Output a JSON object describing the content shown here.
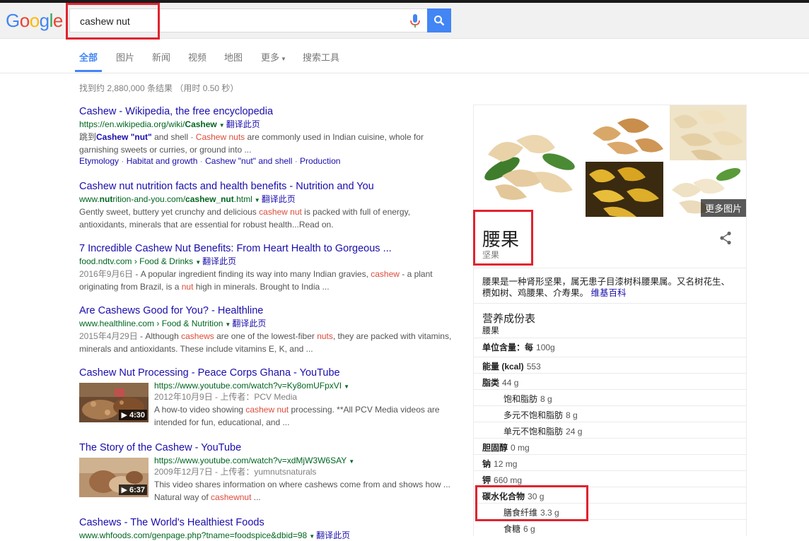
{
  "header": {
    "logo_letters": [
      {
        "ch": "G",
        "color": "#4285f4"
      },
      {
        "ch": "o",
        "color": "#ea4335"
      },
      {
        "ch": "o",
        "color": "#fbbc05"
      },
      {
        "ch": "g",
        "color": "#4285f4"
      },
      {
        "ch": "l",
        "color": "#34a853"
      },
      {
        "ch": "e",
        "color": "#ea4335"
      }
    ],
    "search_value": "cashew nut",
    "mic_icon": "microphone-icon",
    "search_icon": "magnifier-icon"
  },
  "tabs": [
    {
      "label": "全部",
      "active": true
    },
    {
      "label": "图片"
    },
    {
      "label": "新闻"
    },
    {
      "label": "视频"
    },
    {
      "label": "地图"
    },
    {
      "label": "更多"
    },
    {
      "label": "搜索工具"
    }
  ],
  "stats": "找到约 2,880,000 条结果 （用时 0.50 秒）",
  "results": [
    {
      "title": "Cashew - Wikipedia, the free encyclopedia",
      "url_pre": "https://en.wikipedia.org/wiki/",
      "url_bold": "Cashew",
      "translate": "翻译此页",
      "snip_p1": "跳到",
      "snip_b1": "Cashew \"nut\"",
      "snip_p2": " and shell · ",
      "snip_em": "Cashew nuts",
      "snip_p3": " are commonly used in Indian cuisine, whole for garnishing sweets or curries, or ground into ...",
      "sitelinks": [
        "Etymology",
        "Habitat and growth",
        "Cashew \"nut\" and shell",
        "Production"
      ],
      "sep": " · "
    },
    {
      "title": "Cashew nut nutrition facts and health benefits - Nutrition and You",
      "url_p1": "www.",
      "url_b1": "nut",
      "url_p2": "rition-and-you.com/",
      "url_b2": "cashew_nut",
      "url_p3": ".html",
      "translate": "翻译此页",
      "snip_p1": "Gently sweet, buttery yet crunchy and delicious ",
      "snip_em": "cashew nut",
      "snip_p2": " is packed with full of energy, antioxidants, minerals that are essential for robust health...Read on."
    },
    {
      "title": "7 Incredible Cashew Nut Benefits: From Heart Health to Gorgeous ...",
      "url": "food.ndtv.com › Food & Drinks",
      "translate": "翻译此页",
      "date": "2016年9月6日",
      "snip_p1": " - A popular ingredient finding its way into many Indian gravies, ",
      "snip_em1": "cashew",
      "snip_p2": " - a plant originating from Brazil, is a ",
      "snip_em2": "nut",
      "snip_p3": " high in minerals. Brought to India ..."
    },
    {
      "title": "Are Cashews Good for You? - Healthline",
      "url": "www.healthline.com › Food & Nutrition",
      "translate": "翻译此页",
      "date": "2015年4月29日",
      "snip_p1": " - Although ",
      "snip_em1": "cashews",
      "snip_p2": " are one of the lowest-fiber ",
      "snip_em2": "nuts",
      "snip_p3": ", they are packed with vitamins, minerals and antioxidants. These include vitamins E, K, and ..."
    },
    {
      "title": "Cashew Nut Processing - Peace Corps Ghana - YouTube",
      "url": "https://www.youtube.com/watch?v=Ky8omUFpxVI",
      "meta": "2012年10月9日 - 上传者：PCV Media",
      "snip_p1": "A how-to video showing ",
      "snip_em": "cashew nut",
      "snip_p2": " processing. **All PCV Media videos are intended for fun, educational, and ...",
      "duration": "▶ 4:30"
    },
    {
      "title": "The Story of the Cashew - YouTube",
      "url": "https://www.youtube.com/watch?v=xdMjW3W6SAY",
      "meta": "2009年12月7日 - 上传者：yumnutsnaturals",
      "snip_p1": "This video shares information on where cashews come from and shows how ... Natural way of ",
      "snip_em": "cashewnut",
      "snip_p2": " ...",
      "duration": "▶ 6:37"
    },
    {
      "title": "Cashews - The World's Healthiest Foods",
      "url": "www.whfoods.com/genpage.php?tname=foodspice&dbid=98",
      "translate": "翻译此页"
    }
  ],
  "knowledge_panel": {
    "more_images": "更多图片",
    "title": "腰果",
    "subtitle": "坚果",
    "share_icon": "share-icon",
    "description": "腰果是一种肾形坚果，属无患子目漆树科腰果属。又名树花生、槚如树、鸡腰果、介寿果。",
    "desc_link": "维基百科",
    "nutrition_heading": "营养成份表",
    "nutrition_sub": "腰果",
    "nutrition": [
      {
        "label": "单位含量：每",
        "value": "100g",
        "bold": true,
        "indent": false
      },
      {
        "label": "能量 (kcal)",
        "value": "553",
        "bold": true,
        "indent": false
      },
      {
        "label": "脂类",
        "value": "44 g",
        "bold": true,
        "indent": false
      },
      {
        "label": "饱和脂肪",
        "value": "8 g",
        "bold": false,
        "indent": true
      },
      {
        "label": "多元不饱和脂肪",
        "value": "8 g",
        "bold": false,
        "indent": true
      },
      {
        "label": "单元不饱和脂肪",
        "value": "24 g",
        "bold": false,
        "indent": true
      },
      {
        "label": "胆固醇",
        "value": "0 mg",
        "bold": true,
        "indent": false
      },
      {
        "label": "钠",
        "value": "12 mg",
        "bold": true,
        "indent": false
      },
      {
        "label": "钾",
        "value": "660 mg",
        "bold": true,
        "indent": false
      },
      {
        "label": "碳水化合物",
        "value": "30 g",
        "bold": true,
        "indent": false
      },
      {
        "label": "膳食纤维",
        "value": "3.3 g",
        "bold": false,
        "indent": true
      },
      {
        "label": "食糖",
        "value": "6 g",
        "bold": false,
        "indent": true
      }
    ]
  }
}
